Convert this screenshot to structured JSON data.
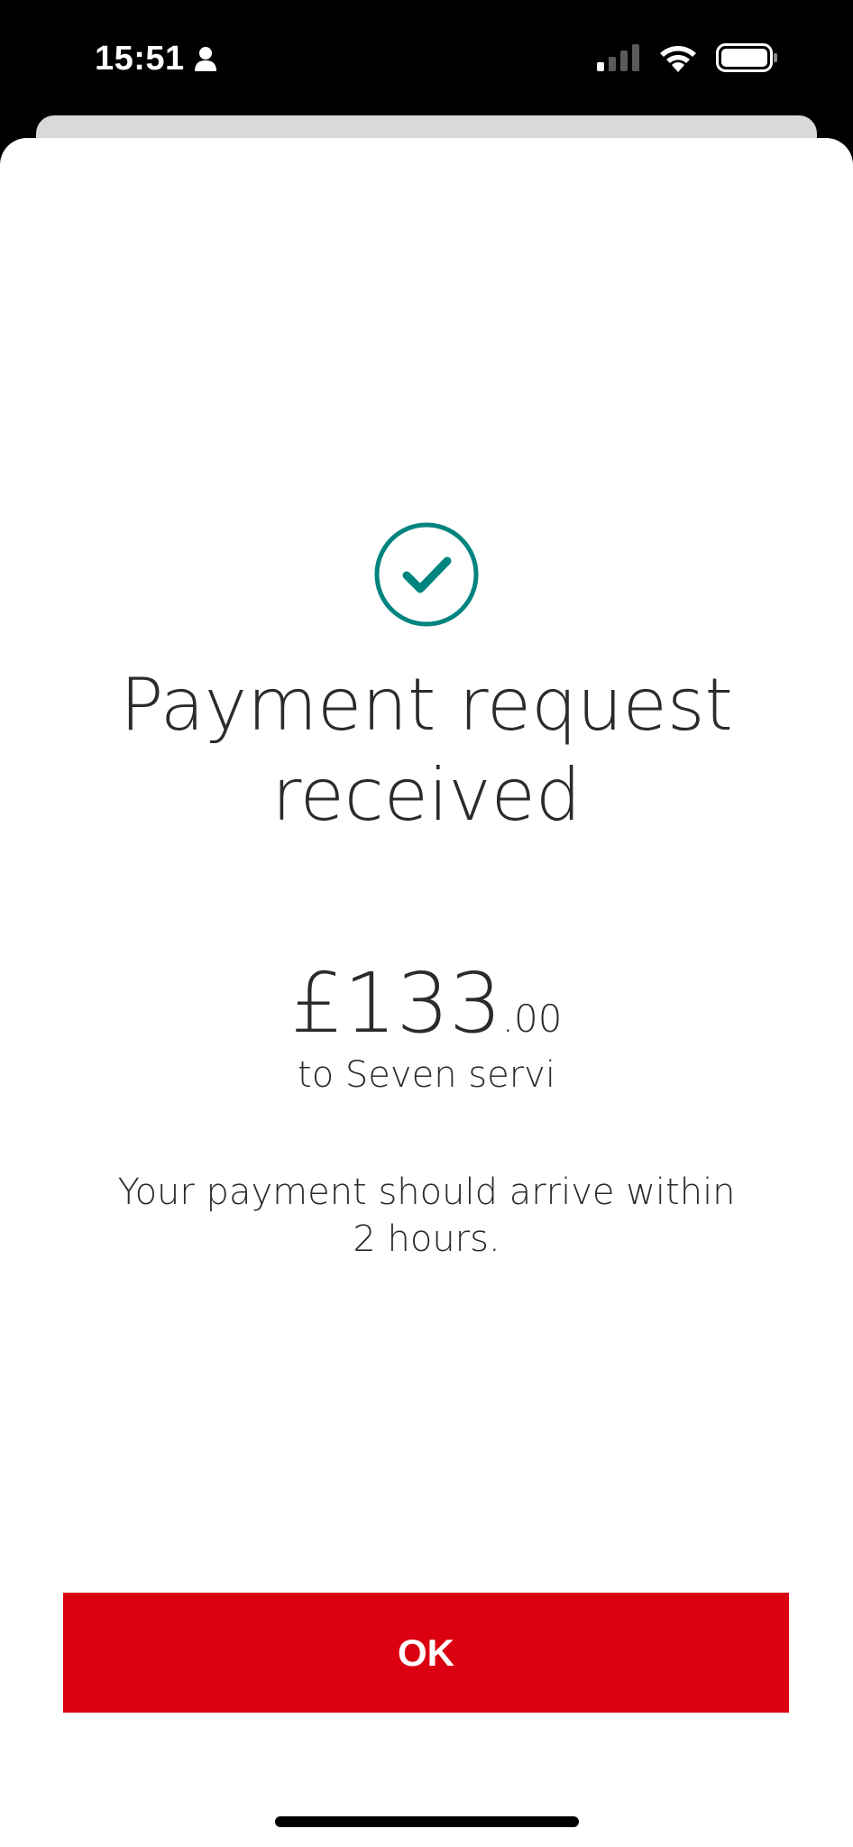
{
  "status_bar": {
    "time": "15:51",
    "icons": [
      "person-icon",
      "cellular-signal-icon",
      "wifi-icon",
      "battery-icon"
    ]
  },
  "confirmation": {
    "icon": "check-circle-icon",
    "title_line1": "Payment request",
    "title_line2": "received",
    "amount_main": "£133",
    "amount_minor": ".00",
    "recipient": "to Seven servi",
    "message_line1": "Your payment should arrive within",
    "message_line2": "2 hours."
  },
  "actions": {
    "ok_label": "OK"
  },
  "colors": {
    "accent_red": "#db0011",
    "check_teal": "#00847f",
    "text_dark": "#2b2b2b"
  }
}
